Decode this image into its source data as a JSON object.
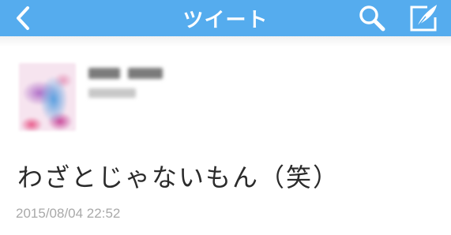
{
  "navbar": {
    "title": "ツイート",
    "background_color": "#55acee",
    "icons": {
      "back": "chevron-left-icon",
      "search": "search-icon",
      "compose": "compose-icon"
    }
  },
  "tweet": {
    "text": "わざとじゃないもん（笑）",
    "timestamp": "2015/08/04 22:52"
  }
}
